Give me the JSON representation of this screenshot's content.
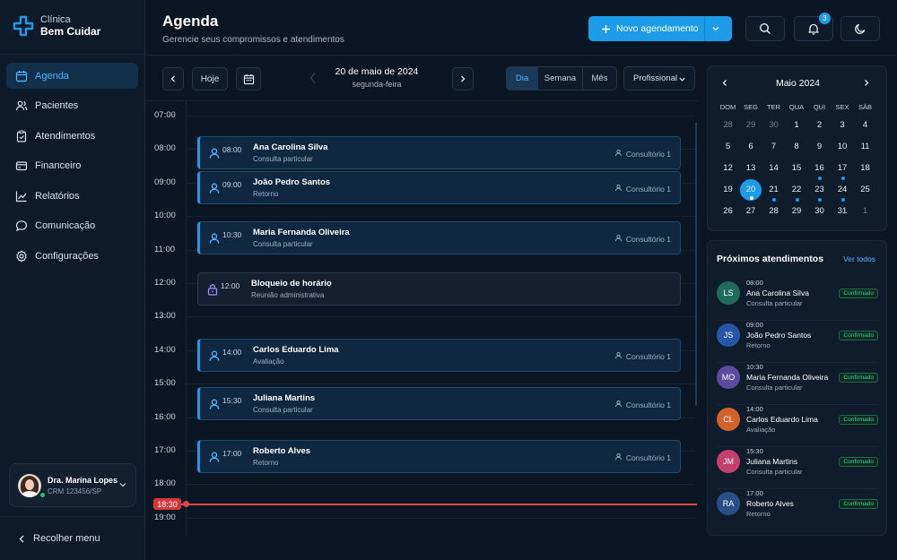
{
  "brand": {
    "line1": "Clínica",
    "line2": "Bem Cuidar",
    "accent": "#1c9be8"
  },
  "sidebar": {
    "items": [
      {
        "label": "Agenda",
        "icon": "calendar-icon"
      },
      {
        "label": "Pacientes",
        "icon": "users-icon"
      },
      {
        "label": "Atendimentos",
        "icon": "clipboard-icon"
      },
      {
        "label": "Financeiro",
        "icon": "wallet-icon"
      },
      {
        "label": "Relatórios",
        "icon": "chart-icon"
      },
      {
        "label": "Comunicação",
        "icon": "chat-icon"
      },
      {
        "label": "Configurações",
        "icon": "gear-icon"
      }
    ],
    "active_item": "Agenda",
    "user": {
      "name": "Dra. Marina Lopes",
      "crm": "CRM 123456/SP"
    },
    "collapse_label": "Recolher menu"
  },
  "header": {
    "title": "Agenda",
    "subtitle": "Gerencie seus compromissos e atendimentos",
    "new_button": "Novo agendamento",
    "notifications_count": "3"
  },
  "toolbar": {
    "today_label": "Hoje",
    "date_title": "20 de maio de 2024",
    "date_sub": "segunda-feira",
    "views": {
      "day": "Dia",
      "week": "Semana",
      "month": "Mês"
    },
    "active_view": "Dia",
    "professional_label": "Profissional"
  },
  "schedule": {
    "hours": [
      "07:00",
      "08:00",
      "09:00",
      "10:00",
      "11:00",
      "12:00",
      "13:00",
      "14:00",
      "15:00",
      "16:00",
      "17:00",
      "18:00",
      "19:00"
    ],
    "now_label": "18:30",
    "appointments": [
      {
        "time": "08:00",
        "name": "Ana Carolina Silva",
        "type": "Consulta particular",
        "room": "Consultório 1"
      },
      {
        "time": "09:00",
        "name": "João Pedro Santos",
        "type": "Retorno",
        "room": "Consultório 1"
      },
      {
        "time": "10:30",
        "name": "Maria Fernanda Oliveira",
        "type": "Consulta particular",
        "room": "Consultório 1"
      },
      {
        "time": "12:00",
        "name": "Bloqueio de horário",
        "type": "Reunião administrativa",
        "room": ""
      },
      {
        "time": "14:00",
        "name": "Carlos Eduardo Lima",
        "type": "Avaliação",
        "room": "Consultório 1"
      },
      {
        "time": "15:30",
        "name": "Juliana Martins",
        "type": "Consulta particular",
        "room": "Consultório 1"
      },
      {
        "time": "17:00",
        "name": "Roberto Alves",
        "type": "Retorno",
        "room": "Consultório 1"
      }
    ]
  },
  "calendar": {
    "month": "Maio 2024",
    "dow": [
      "DOM",
      "SEG",
      "TER",
      "QUA",
      "QUI",
      "SEX",
      "SÁB"
    ],
    "weeks": [
      [
        "28",
        "29",
        "30",
        "1",
        "2",
        "3",
        "4"
      ],
      [
        "5",
        "6",
        "7",
        "8",
        "9",
        "10",
        "11"
      ],
      [
        "12",
        "13",
        "14",
        "15",
        "16",
        "17",
        "18"
      ],
      [
        "19",
        "20",
        "21",
        "22",
        "23",
        "24",
        "25"
      ],
      [
        "26",
        "27",
        "28",
        "29",
        "30",
        "31",
        "1"
      ]
    ],
    "selected": "20",
    "event_days": [
      "16",
      "17",
      "20",
      "21",
      "22",
      "23",
      "24"
    ]
  },
  "upcoming": {
    "title": "Próximos atendimentos",
    "see_all": "Ver todos",
    "items": [
      {
        "initials": "LS",
        "time": "08:00",
        "name": "Ana Carolina Silva",
        "type": "Consulta particular",
        "status": "Confirmado",
        "color": "#1f6b5e"
      },
      {
        "initials": "JS",
        "time": "09:00",
        "name": "João Pedro Santos",
        "type": "Retorno",
        "status": "Confirmado",
        "color": "#2856a6"
      },
      {
        "initials": "MO",
        "time": "10:30",
        "name": "Maria Fernanda Oliveira",
        "type": "Consulta particular",
        "status": "Confirmado",
        "color": "#5b4a9e"
      },
      {
        "initials": "CL",
        "time": "14:00",
        "name": "Carlos Eduardo Lima",
        "type": "Avaliação",
        "status": "Confirmado",
        "color": "#d2622a"
      },
      {
        "initials": "JM",
        "time": "15:30",
        "name": "Juliana Martins",
        "type": "Consulta particular",
        "status": "Confirmado",
        "color": "#c2406b"
      },
      {
        "initials": "RA",
        "time": "17:00",
        "name": "Roberto Alves",
        "type": "Retorno",
        "status": "Confirmado",
        "color": "#2a4f86"
      }
    ]
  }
}
